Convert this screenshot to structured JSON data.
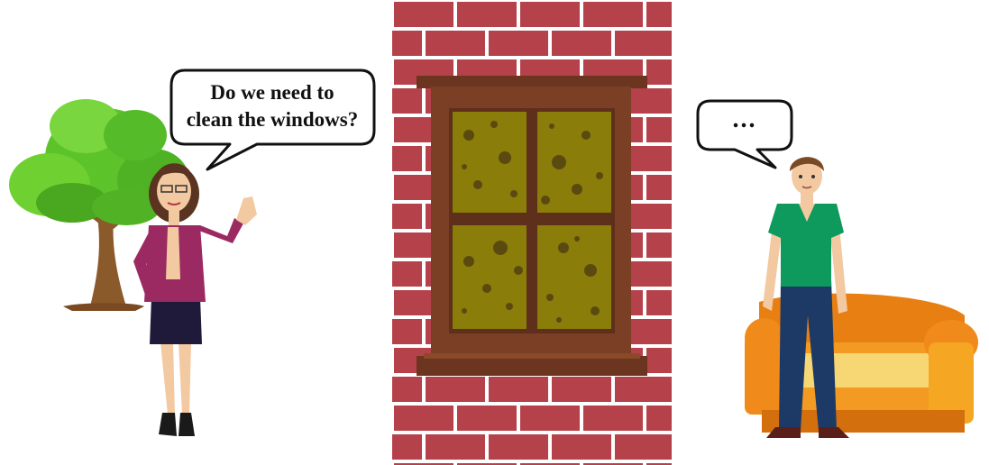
{
  "scene": {
    "woman_speech": {
      "line1": "Do we need to",
      "line2": "clean the windows?"
    },
    "man_speech": {
      "text": "..."
    }
  },
  "colors": {
    "brick": "#b5414a",
    "mortar": "#ffffff",
    "window_frame": "#7a3f24",
    "window_glass": "#8a7d0a",
    "dirt_spots": "#5a4a10",
    "woman_jacket": "#9c2a62",
    "woman_skirt": "#1f1a3a",
    "man_shirt": "#0e9a5c",
    "man_jeans": "#1d3a66",
    "sofa": "#f08a1a",
    "sofa_cushion": "#f7d773",
    "tree_leaves": "#5cc42a",
    "tree_trunk": "#8b5a2b"
  }
}
